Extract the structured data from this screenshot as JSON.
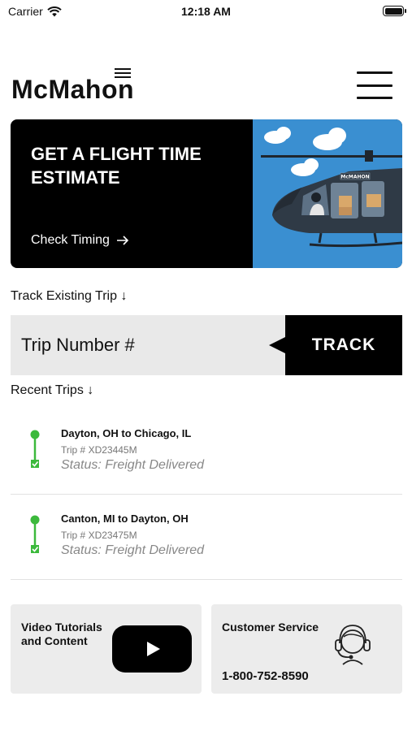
{
  "status_bar": {
    "carrier": "Carrier",
    "time": "12:18 AM"
  },
  "header": {
    "logo_text": "McMahon"
  },
  "banner": {
    "title": "GET A FLIGHT TIME ESTIMATE",
    "cta_label": "Check Timing",
    "cta_icon": "arrow-right-icon",
    "helicopter_logo_text": "McMAHON",
    "colors": {
      "background": "#000000",
      "sky": "#3a8fd1",
      "helicopter": "#2f3a46"
    }
  },
  "track": {
    "label": "Track Existing Trip ↓",
    "input_placeholder": "Trip Number #",
    "button_label": "TRACK"
  },
  "recent": {
    "label": "Recent Trips ↓",
    "trips": [
      {
        "route": "Dayton, OH to Chicago, IL",
        "trip_number": "Trip # XD23445M",
        "status": "Status: Freight Delivered"
      },
      {
        "route": "Canton, MI to Dayton, OH",
        "trip_number": "Trip # XD23475M",
        "status": "Status: Freight Delivered"
      }
    ],
    "colors": {
      "status_green": "#3cb93c"
    }
  },
  "cards": {
    "video": {
      "title": "Video Tutorials and Content",
      "icon": "play-icon"
    },
    "service": {
      "title": "Customer Service",
      "phone": "1-800-752-8590",
      "icon": "headset-icon"
    }
  }
}
